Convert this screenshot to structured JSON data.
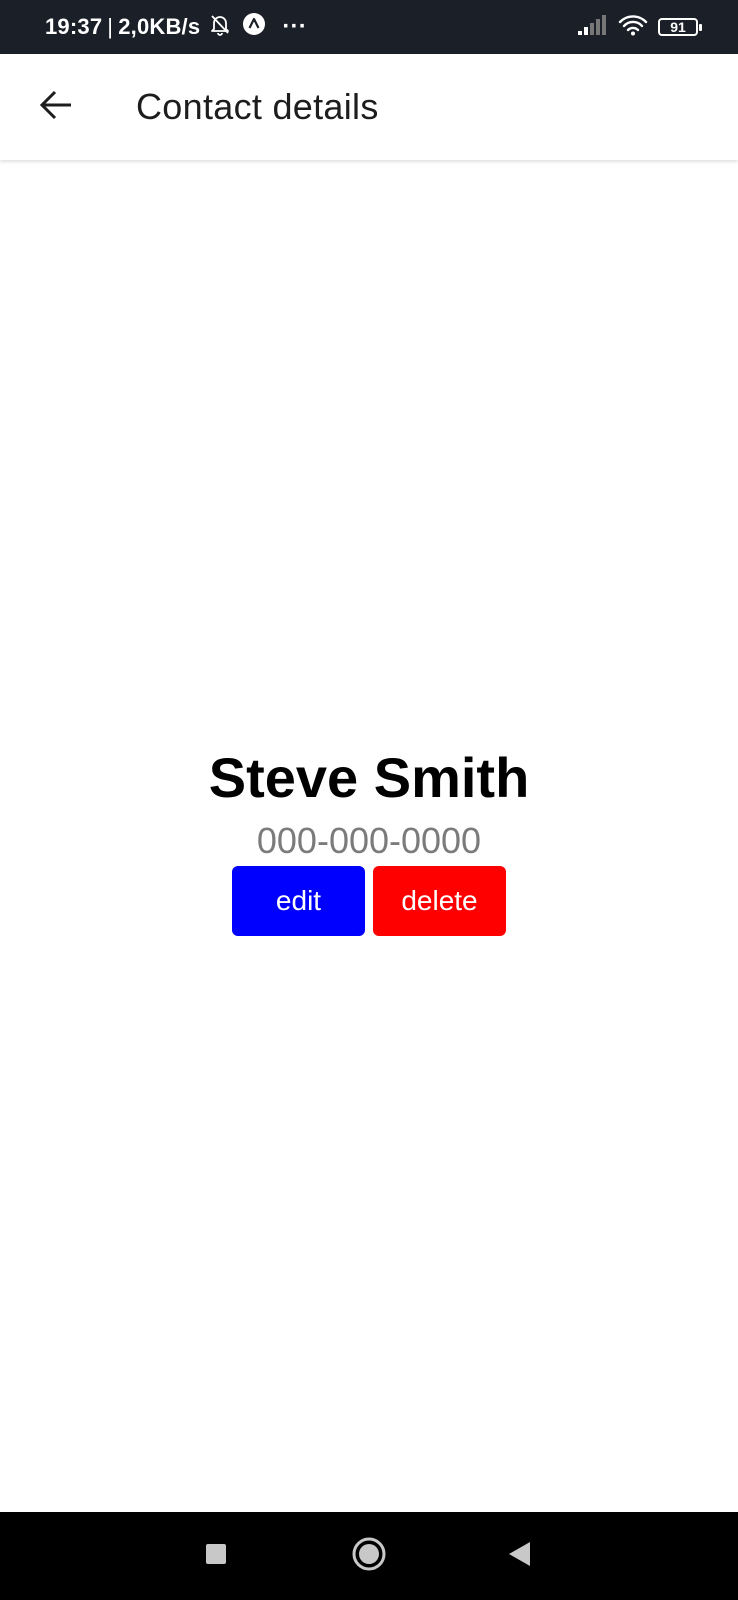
{
  "status_bar": {
    "time": "19:37",
    "separator": "|",
    "net_speed": "2,0KB/s",
    "more_dots": "···",
    "battery": "91",
    "icons": [
      "bell-off-icon",
      "app-notification-icon",
      "signal-icon",
      "wifi-icon",
      "battery-icon"
    ]
  },
  "app_bar": {
    "back_icon": "arrow-left-icon",
    "title": "Contact details"
  },
  "contact": {
    "name": "Steve Smith",
    "phone": "000-000-0000"
  },
  "actions": {
    "edit_label": "edit",
    "delete_label": "delete",
    "edit_color": "#0000ff",
    "delete_color": "#ff0000"
  },
  "nav_bar": {
    "icons": [
      "recents-square-icon",
      "home-circle-icon",
      "back-triangle-icon"
    ]
  }
}
